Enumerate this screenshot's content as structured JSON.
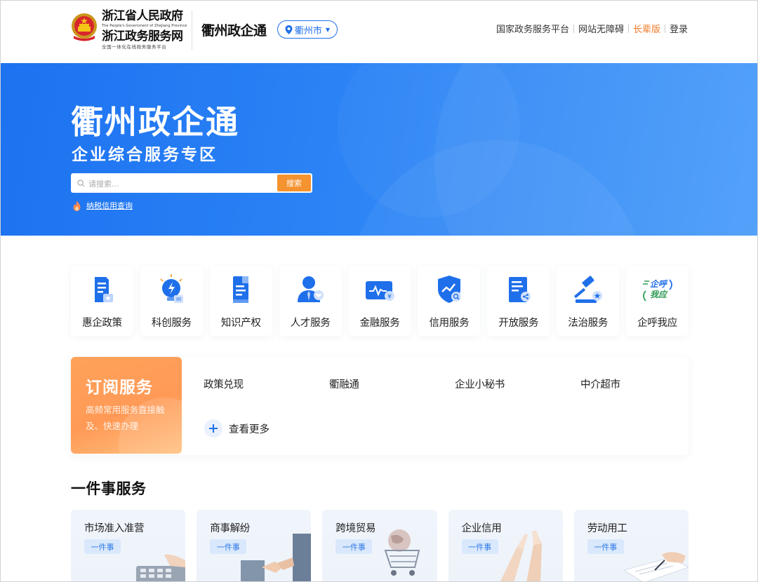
{
  "header": {
    "gov_name_line1": "浙江省人民政府",
    "gov_name_en": "The People's Government of Zhejiang Province",
    "gov_name_line2": "浙江政务服务网",
    "gov_slogan": "全国一体化在线政务服务平台",
    "site_name": "衢州政企通",
    "city_selector": "衢州市",
    "links": [
      {
        "label": "国家政务服务平台"
      },
      {
        "label": "网站无障碍"
      },
      {
        "label": "长辈版"
      },
      {
        "label": "登录"
      }
    ]
  },
  "banner": {
    "title": "衢州政企通",
    "subtitle": "企业综合服务专区",
    "search_placeholder": "请搜索...",
    "search_button": "搜索",
    "tax_link": "纳税信用查询"
  },
  "services": [
    {
      "label": "惠企政策",
      "icon": "policy-doc-icon"
    },
    {
      "label": "科创服务",
      "icon": "lightbulb-icon"
    },
    {
      "label": "知识产权",
      "icon": "ip-doc-icon"
    },
    {
      "label": "人才服务",
      "icon": "person-icon"
    },
    {
      "label": "金融服务",
      "icon": "finance-card-icon"
    },
    {
      "label": "信用服务",
      "icon": "credit-shield-icon"
    },
    {
      "label": "开放服务",
      "icon": "open-doc-icon"
    },
    {
      "label": "法治服务",
      "icon": "gavel-icon"
    },
    {
      "label": "企呼我应",
      "icon": "qi-hu-wo-ying-logo"
    }
  ],
  "subscription": {
    "title": "订阅服务",
    "desc": "高频常用服务直接触及、快速办理",
    "items": [
      "政策兑现",
      "衢融通",
      "企业小秘书",
      "中介超市"
    ],
    "more": "查看更多"
  },
  "one_thing": {
    "title": "一件事服务",
    "cards": [
      {
        "name": "市场准入准营",
        "tag": "一件事"
      },
      {
        "name": "商事解纷",
        "tag": "一件事"
      },
      {
        "name": "跨境贸易",
        "tag": "一件事"
      },
      {
        "name": "企业信用",
        "tag": "一件事"
      },
      {
        "name": "劳动用工",
        "tag": "一件事"
      }
    ]
  },
  "colors": {
    "primary": "#1f6fea",
    "banner": "#2b83f5",
    "orange": "#f59330",
    "elder": "#f07a28"
  }
}
